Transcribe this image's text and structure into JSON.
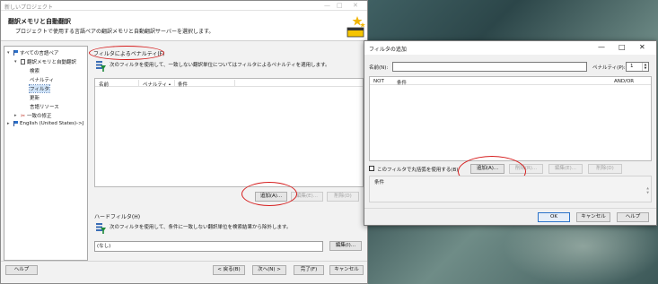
{
  "main_window": {
    "title": "新しいプロジェクト",
    "controls": {
      "minimize": "—",
      "maximize": "□",
      "close": "✕"
    },
    "header_title": "翻訳メモリと自動翻訳",
    "header_subtitle": "プロジェクトで使用する言語ペアの翻訳メモリと自動翻訳サーバーを選択します。"
  },
  "nav_tree": [
    {
      "label": "すべての言語ペア",
      "icon": "flag-icon",
      "twisty": "▾"
    },
    {
      "label": "翻訳メモリと自動翻訳",
      "icon": "document-icon",
      "twisty": "▾"
    },
    {
      "label": "検索",
      "icon": "",
      "twisty": ""
    },
    {
      "label": "ペナルティ",
      "icon": "",
      "twisty": ""
    },
    {
      "label": "フィルタ",
      "icon": "",
      "twisty": "",
      "selected": true
    },
    {
      "label": "更新",
      "icon": "",
      "twisty": ""
    },
    {
      "label": "言語リソース",
      "icon": "",
      "twisty": ""
    },
    {
      "label": "一致の修正",
      "icon": "tool-icon",
      "twisty": "▸"
    },
    {
      "label": "English (United States)->J",
      "icon": "flag-icon",
      "twisty": "▸"
    }
  ],
  "filter_section": {
    "label": "フィルタによるペナルティ(F)",
    "description": "次のフィルタを使用して、一致しない翻訳単位についてはフィルタによるペナルティを適用します。",
    "columns": [
      "名前",
      "ペナルティ",
      "▴",
      "条件"
    ],
    "buttons": {
      "add": "追加(A)...",
      "edit": "編集(E)...",
      "delete": "削除(D)"
    }
  },
  "hard_filter_section": {
    "label": "ハードフィルタ(H)",
    "description": "次のフィルタを使用して、条件に一致しない翻訳単位を検索結果から除外します。",
    "value": "(なし)",
    "edit_button": "編集(I)..."
  },
  "footer": {
    "help": "ヘルプ",
    "back": "< 戻る(B)",
    "next": "次へ(N) >",
    "finish": "完了(F)",
    "cancel": "キャンセル"
  },
  "dialog": {
    "title": "フィルタの追加",
    "controls": {
      "minimize": "—",
      "maximize": "□",
      "close": "✕"
    },
    "name_label": "名前(N):",
    "name_value": "",
    "penalty_label": "ペナルティ(P):",
    "penalty_value": "1",
    "columns": [
      "NOT",
      "条件",
      "AND/OR"
    ],
    "checkbox_label": "このフィルタで丸括弧を使用する(B)",
    "buttons": {
      "add": "追加(A)...",
      "delete": "削除(R)...",
      "edit": "編集(E)...",
      "remove": "削除(D)"
    },
    "condition_label": "条件",
    "ok": "OK",
    "cancel": "キャンセル",
    "help": "ヘルプ"
  },
  "colors": {
    "annotation_circle": "#d61f1f",
    "selection": "#cfe3f8",
    "default_button_border": "#2a72c9"
  }
}
